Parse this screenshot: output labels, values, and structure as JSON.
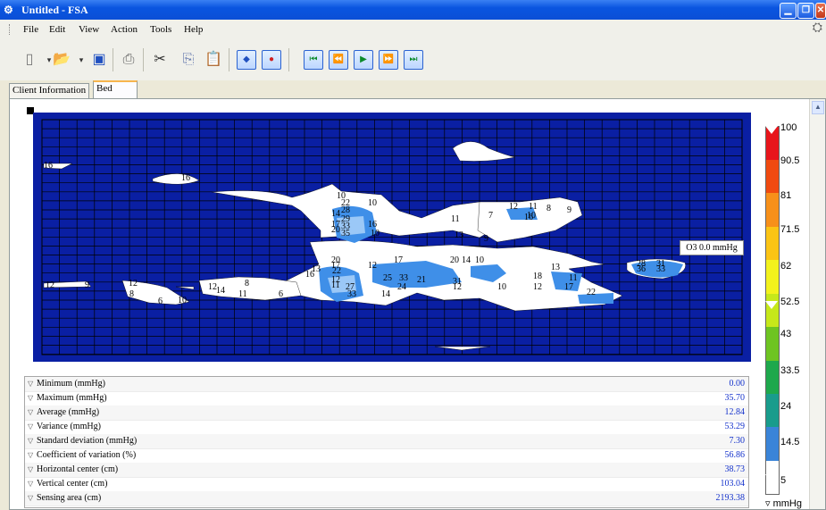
{
  "window": {
    "title": "Untitled - FSA",
    "icon": "app-icon"
  },
  "menu": [
    {
      "label": "File"
    },
    {
      "label": "Edit"
    },
    {
      "label": "View"
    },
    {
      "label": "Action"
    },
    {
      "label": "Tools"
    },
    {
      "label": "Help"
    }
  ],
  "toolbar": {
    "icons": [
      "new-icon",
      "open-icon",
      "save-icon",
      "print-icon",
      "cut-icon",
      "copy-icon",
      "paste-icon",
      "record-icon",
      "stop-icon",
      "first-icon",
      "rewind-icon",
      "play-icon",
      "forward-icon",
      "last-icon"
    ]
  },
  "tabs": [
    {
      "label": "Client Information",
      "active": false
    },
    {
      "label": "Bed",
      "active": true
    }
  ],
  "bed": {
    "sensor_tooltip": "O3  0.0 mmHg",
    "colors": {
      "background": "#0a1fa3",
      "grid": "#000000",
      "low": "#ffffff",
      "mid": "#3f8fe8",
      "high": "#9bc8f7"
    },
    "cell_values": [
      {
        "text": "16"
      },
      {
        "text": "16"
      },
      {
        "text": "12"
      },
      {
        "text": "9"
      },
      {
        "text": "12"
      },
      {
        "text": "8"
      },
      {
        "text": "6"
      },
      {
        "text": "10"
      },
      {
        "text": "12"
      },
      {
        "text": "8"
      },
      {
        "text": "14"
      },
      {
        "text": "16"
      },
      {
        "text": "11"
      },
      {
        "text": "6"
      },
      {
        "text": "17"
      },
      {
        "text": "20"
      },
      {
        "text": "14"
      },
      {
        "text": "10"
      },
      {
        "text": "10"
      },
      {
        "text": "22"
      },
      {
        "text": "28"
      },
      {
        "text": "29"
      },
      {
        "text": "33"
      },
      {
        "text": "35"
      },
      {
        "text": "16"
      },
      {
        "text": "10"
      },
      {
        "text": "20"
      },
      {
        "text": "17"
      },
      {
        "text": "22"
      },
      {
        "text": "12"
      },
      {
        "text": "13"
      },
      {
        "text": "12"
      },
      {
        "text": "11"
      },
      {
        "text": "17"
      },
      {
        "text": "20"
      },
      {
        "text": "14"
      },
      {
        "text": "10"
      },
      {
        "text": "18"
      },
      {
        "text": "11"
      },
      {
        "text": "25"
      },
      {
        "text": "33"
      },
      {
        "text": "21"
      },
      {
        "text": "27"
      },
      {
        "text": "24"
      },
      {
        "text": "31"
      },
      {
        "text": "33"
      },
      {
        "text": "14"
      },
      {
        "text": "12"
      },
      {
        "text": "10"
      },
      {
        "text": "12"
      },
      {
        "text": "17"
      },
      {
        "text": "22"
      },
      {
        "text": "13"
      },
      {
        "text": "9"
      },
      {
        "text": "11"
      },
      {
        "text": "7"
      },
      {
        "text": "16"
      },
      {
        "text": "10"
      },
      {
        "text": "8"
      },
      {
        "text": "9"
      },
      {
        "text": "11"
      },
      {
        "text": "12"
      },
      {
        "text": "13"
      },
      {
        "text": "28"
      },
      {
        "text": "31"
      },
      {
        "text": "36"
      },
      {
        "text": "33"
      }
    ]
  },
  "stats": [
    {
      "label": "Minimum (mmHg)",
      "value": "0.00"
    },
    {
      "label": "Maximum (mmHg)",
      "value": "35.70"
    },
    {
      "label": "Average (mmHg)",
      "value": "12.84"
    },
    {
      "label": "Variance (mmHg)",
      "value": "53.29"
    },
    {
      "label": "Standard deviation (mmHg)",
      "value": "7.30"
    },
    {
      "label": "Coefficient of variation (%)",
      "value": "56.86"
    },
    {
      "label": "Horizontal center (cm)",
      "value": "38.73"
    },
    {
      "label": "Vertical center (cm)",
      "value": "103.04"
    },
    {
      "label": "Sensing area (cm)",
      "value": "2193.38"
    }
  ],
  "scale": {
    "labels": [
      "100",
      "90.5",
      "81",
      "71.5",
      "62",
      "52.5",
      "43",
      "33.5",
      "24",
      "14.5",
      "5"
    ],
    "unit": "mmHg",
    "colors": [
      "#e8151b",
      "#f04a10",
      "#f7901a",
      "#fbc414",
      "#f3f21c",
      "#c6e81a",
      "#6ec422",
      "#1ea84c",
      "#199c8c",
      "#3a84d8",
      "#9ac4f4",
      "#ffffff"
    ]
  }
}
